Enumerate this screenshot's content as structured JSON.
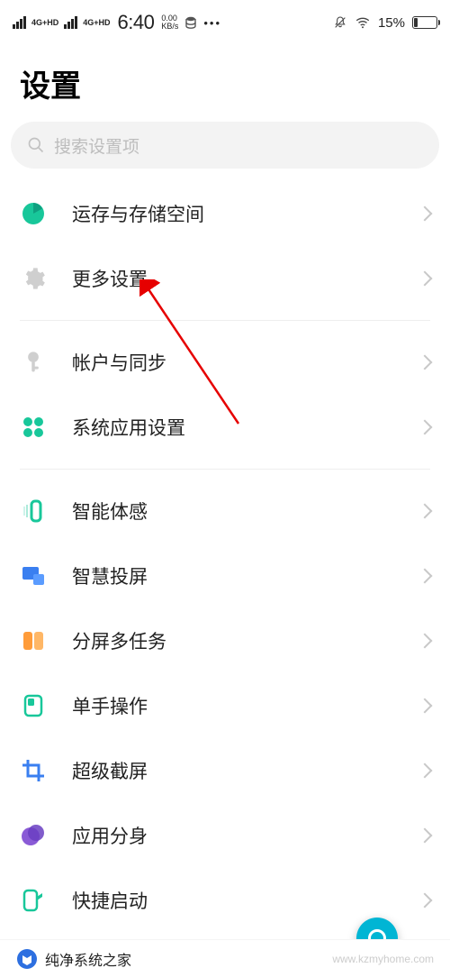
{
  "status": {
    "net1": "4G+HD",
    "net2": "4G+HD",
    "time": "6:40",
    "kbs_top": "0.00",
    "kbs_bot": "KB/s",
    "battery": "15%"
  },
  "title": "设置",
  "search": {
    "placeholder": "搜索设置项"
  },
  "items": [
    {
      "label": "运存与存储空间"
    },
    {
      "label": "更多设置"
    },
    {
      "label": "帐户与同步"
    },
    {
      "label": "系统应用设置"
    },
    {
      "label": "智能体感"
    },
    {
      "label": "智慧投屏"
    },
    {
      "label": "分屏多任务"
    },
    {
      "label": "单手操作"
    },
    {
      "label": "超级截屏"
    },
    {
      "label": "应用分身"
    },
    {
      "label": "快捷启动"
    }
  ],
  "footer": {
    "brand": "纯净系统之家",
    "url": "www.kzmyhome.com"
  }
}
